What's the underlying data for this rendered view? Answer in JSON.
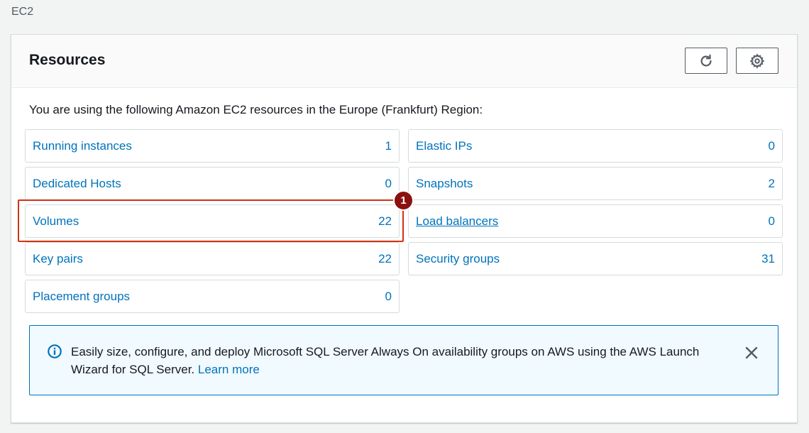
{
  "breadcrumb": "EC2",
  "panel": {
    "title": "Resources",
    "refresh_icon": "refresh-icon",
    "settings_icon": "gear-icon"
  },
  "intro": "You are using the following Amazon EC2 resources in the Europe (Frankfurt) Region:",
  "resources_left": [
    {
      "label": "Running instances",
      "count": "1"
    },
    {
      "label": "Dedicated Hosts",
      "count": "0"
    },
    {
      "label": "Volumes",
      "count": "22"
    },
    {
      "label": "Key pairs",
      "count": "22"
    },
    {
      "label": "Placement groups",
      "count": "0"
    }
  ],
  "resources_right": [
    {
      "label": "Elastic IPs",
      "count": "0"
    },
    {
      "label": "Snapshots",
      "count": "2"
    },
    {
      "label": "Load balancers",
      "count": "0"
    },
    {
      "label": "Security groups",
      "count": "31"
    }
  ],
  "annotation": {
    "step": "1"
  },
  "info": {
    "text": "Easily size, configure, and deploy Microsoft SQL Server Always On availability groups on AWS using the AWS Launch Wizard for SQL Server.",
    "link": "Learn more",
    "icon": "info-icon",
    "close_icon": "close-icon"
  },
  "colors": {
    "link": "#0073bb",
    "highlight": "#d13212",
    "badge": "#8b1010",
    "info_bg": "#f1faff"
  }
}
